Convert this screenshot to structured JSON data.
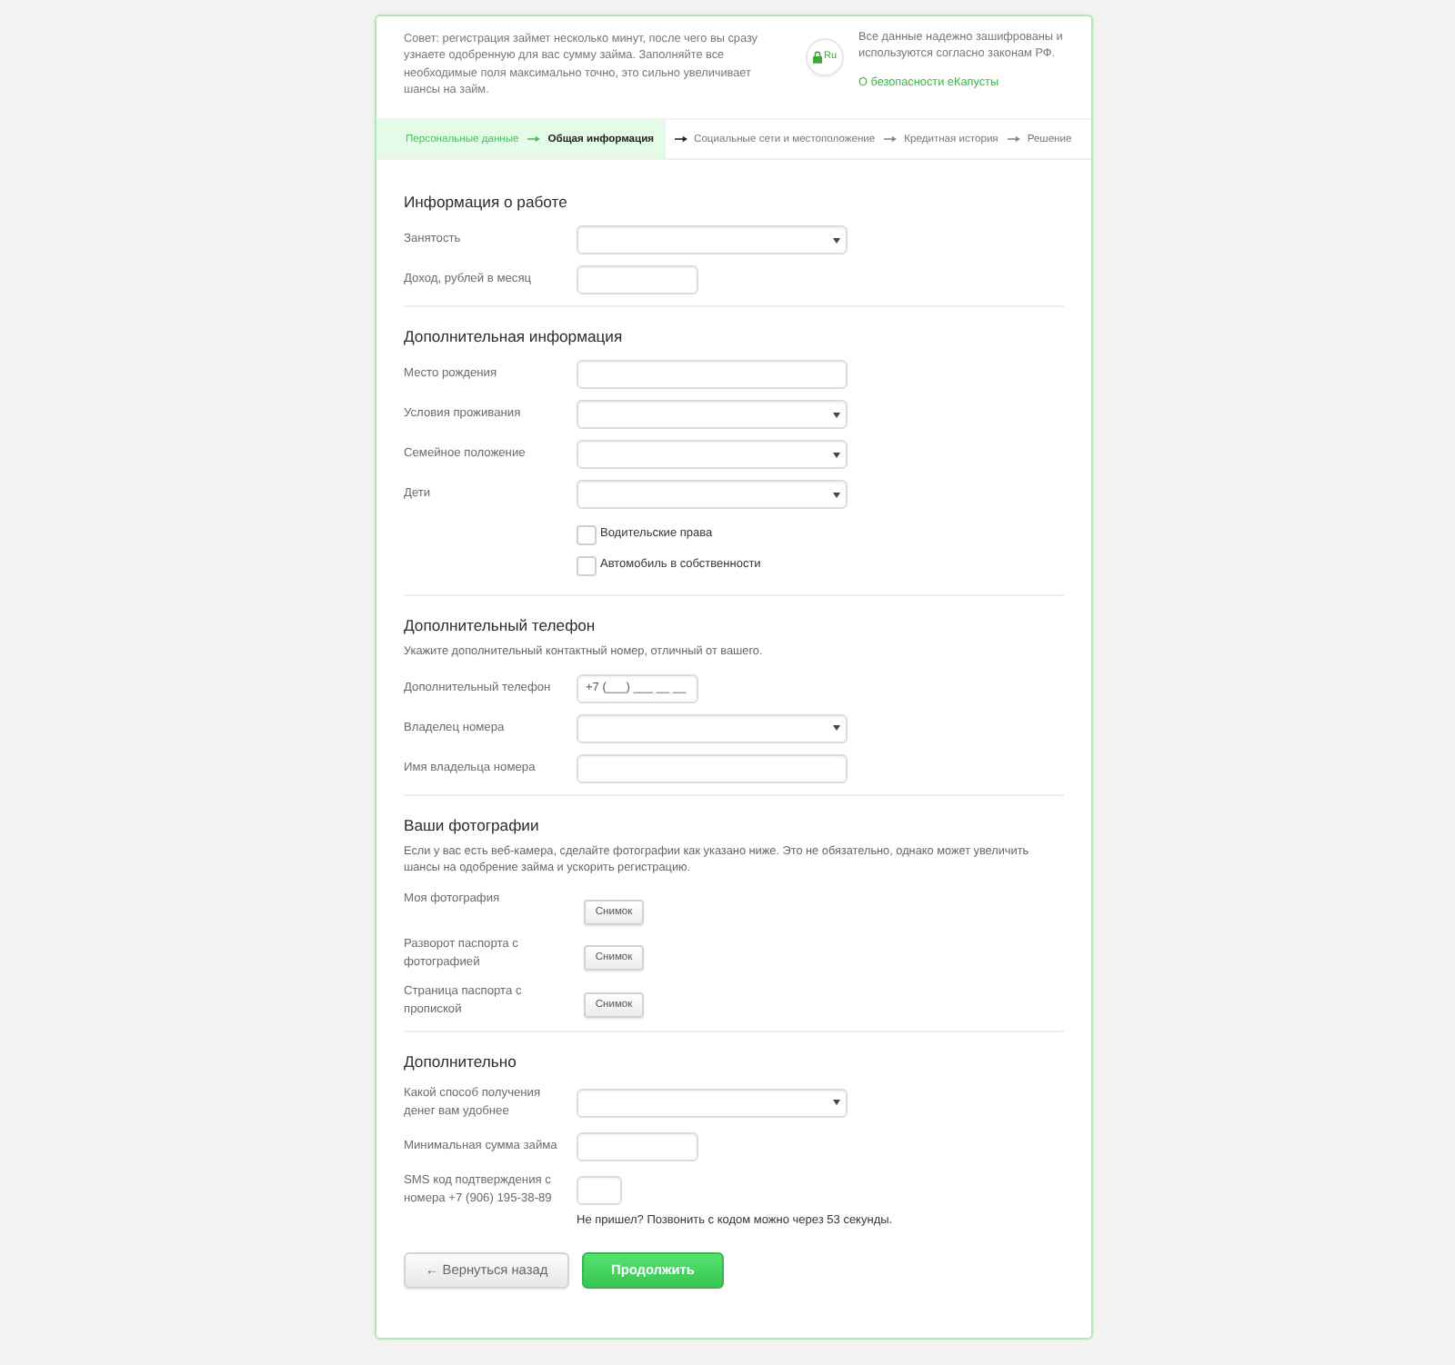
{
  "notice": {
    "tip": "Совет: регистрация займет несколько минут, после чего вы сразу узнаете одобренную для вас сумму займа. Заполняйте все необходимые поля максимально точно, это сильно увеличивает шансы на займ.",
    "badge_text": "Ru",
    "security_text": "Все данные надежно зашифрованы и используются согласно законам РФ.",
    "security_link": "О безопасности еКапусты"
  },
  "steps": [
    {
      "label": "Персональные данные",
      "done": true,
      "selected": false
    },
    {
      "label": "Общая информация",
      "done": false,
      "selected": true
    },
    {
      "label": "Социальные сети и местоположение",
      "done": false,
      "selected": false
    },
    {
      "label": "Кредитная история",
      "done": false,
      "selected": false
    },
    {
      "label": "Решение",
      "done": false,
      "selected": false
    }
  ],
  "sections": [
    {
      "title": "Информация о работе",
      "fields": [
        {
          "kind": "select",
          "label": "Занятость"
        },
        {
          "kind": "amount",
          "label": "Доход, рублей в месяц"
        }
      ]
    },
    {
      "title": "Дополнительная информация",
      "fields": [
        {
          "kind": "text",
          "label": "Место рождения"
        },
        {
          "kind": "select",
          "label": "Условия проживания"
        },
        {
          "kind": "select",
          "label": "Семейное положение"
        },
        {
          "kind": "select",
          "label": "Дети"
        },
        {
          "kind": "checkbox",
          "label": "Водительские права",
          "checked": false
        },
        {
          "kind": "checkbox",
          "label": "Автомобиль в собственности",
          "checked": false
        }
      ]
    },
    {
      "title": "Дополнительный телефон",
      "description": "Укажите дополнительный контактный номер, отличный от вашего.",
      "fields": [
        {
          "kind": "phone",
          "label": "Дополнительный телефон",
          "placeholder": "+7 (___) ___ __ __"
        },
        {
          "kind": "select",
          "label": "Владелец номера"
        },
        {
          "kind": "text",
          "label": "Имя владельца номера"
        }
      ]
    },
    {
      "title": "Ваши фотографии",
      "description": "Если у вас есть веб-камера, сделайте фотографии как указано ниже. Это не обязательно, однако может увеличить шансы на одобрение займа и ускорить регистрацию.",
      "fields": [
        {
          "kind": "photo",
          "label": "Моя фотография",
          "button": "Снимок"
        },
        {
          "kind": "photo",
          "label": "Разворот паспорта с фотографией",
          "button": "Снимок"
        },
        {
          "kind": "photo",
          "label": "Страница паспорта с пропиской",
          "button": "Снимок"
        }
      ]
    },
    {
      "title": "Дополнительно",
      "fields": [
        {
          "kind": "select",
          "label": "Какой способ получения денег вам удобнее"
        },
        {
          "kind": "amount",
          "label": "Минимальная сумма займа"
        },
        {
          "kind": "code",
          "label": "SMS код подтверждения с номера +7 (906) 195-38-89"
        },
        {
          "kind": "note",
          "text": "Не пришел? Позвонить с кодом можно через 53 секунды."
        }
      ]
    }
  ],
  "buttons": [
    {
      "kind": "secondary",
      "label": "← Вернуться назад"
    },
    {
      "kind": "primary",
      "label": "Продолжить"
    }
  ]
}
